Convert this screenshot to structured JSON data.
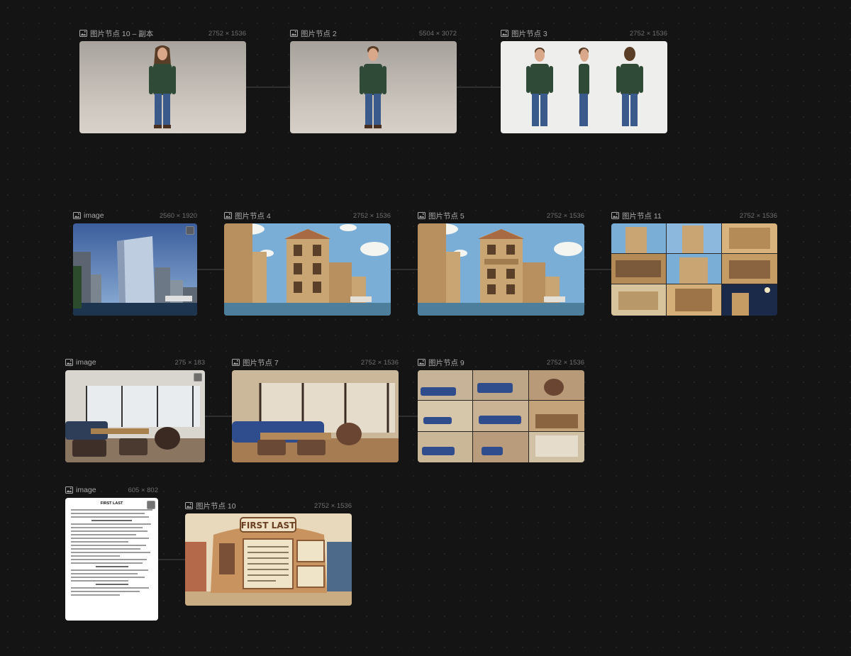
{
  "nodes": [
    {
      "id": "n10copy",
      "title": "图片节点 10 – 副本",
      "dims": "2752 × 1536",
      "thumb": "character-longhair"
    },
    {
      "id": "n2",
      "title": "图片节点 2",
      "dims": "5504 × 3072",
      "thumb": "character-front"
    },
    {
      "id": "n3",
      "title": "图片节点 3",
      "dims": "2752 × 1536",
      "thumb": "character-turnaround"
    },
    {
      "id": "img1",
      "title": "image",
      "dims": "2560 × 1920",
      "thumb": "city-towers-photo"
    },
    {
      "id": "n4",
      "title": "图片节点 4",
      "dims": "2752 × 1536",
      "thumb": "clay-building-canal"
    },
    {
      "id": "n5",
      "title": "图片节点 5",
      "dims": "2752 × 1536",
      "thumb": "clay-building-workspace"
    },
    {
      "id": "n11",
      "title": "图片节点 11",
      "dims": "2752 × 1536",
      "thumb": "workspace-storyboard-grid"
    },
    {
      "id": "img2",
      "title": "image",
      "dims": "275 × 183",
      "thumb": "office-lounge-photo"
    },
    {
      "id": "n7",
      "title": "图片节点 7",
      "dims": "2752 × 1536",
      "thumb": "clay-lounge"
    },
    {
      "id": "n9",
      "title": "图片节点 9",
      "dims": "2752 × 1536",
      "thumb": "lounge-storyboard-grid"
    },
    {
      "id": "img3",
      "title": "image",
      "dims": "605 × 802",
      "thumb": "resume-document",
      "doc_heading": "FIRST LAST"
    },
    {
      "id": "n10",
      "title": "图片节点 10",
      "dims": "2752 × 1536",
      "thumb": "clay-resume-building",
      "sign_text": "FIRST LAST"
    }
  ],
  "colors": {
    "canvas_bg": "#141414",
    "edge": "#4a4a4a",
    "header_text": "#a9a9a9",
    "dims_text": "#6f6f6f",
    "clay_tan": "#c8a573",
    "sky_blue": "#7aaed6"
  }
}
